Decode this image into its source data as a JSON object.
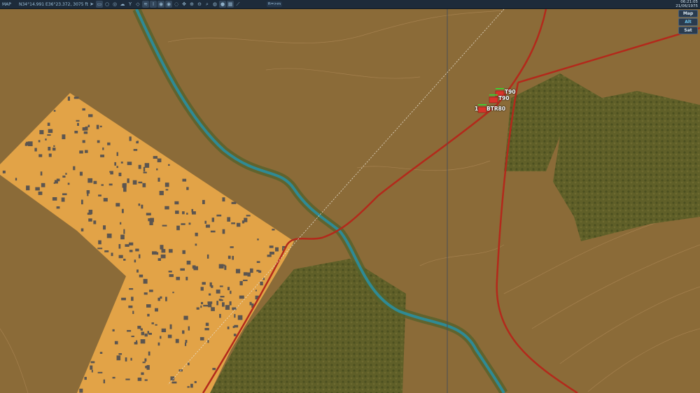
{
  "topbar": {
    "title": "MAP",
    "coords": "N34°14.991 E36°23.372, 3075 ft",
    "units_toggle": "ft=>m",
    "tools": [
      {
        "icon": "navigate-arrow-icon",
        "glyph": "➤",
        "active": false
      },
      {
        "icon": "label-toggle-icon",
        "glyph": "▭",
        "active": true
      },
      {
        "icon": "circle-icon",
        "glyph": "○",
        "active": false
      },
      {
        "icon": "layers-icon",
        "glyph": "◎",
        "active": false
      },
      {
        "icon": "cloud-icon",
        "glyph": "☁",
        "active": false
      },
      {
        "icon": "network-icon",
        "glyph": "Y",
        "active": false
      },
      {
        "icon": "target-icon",
        "glyph": "◇",
        "active": false
      },
      {
        "icon": "wifi-icon",
        "glyph": "≋",
        "active": true
      },
      {
        "icon": "tower-icon",
        "glyph": "I",
        "active": true
      },
      {
        "icon": "radar-1-icon",
        "glyph": "◉",
        "active": true
      },
      {
        "icon": "radar-2-icon",
        "glyph": "◉",
        "active": true
      },
      {
        "icon": "radar-3-icon",
        "glyph": "◌",
        "active": false
      },
      {
        "icon": "move-icon",
        "glyph": "✥",
        "active": false
      },
      {
        "icon": "zoom-in-icon",
        "glyph": "⊕",
        "active": false
      },
      {
        "icon": "zoom-out-icon",
        "glyph": "⊖",
        "active": false
      },
      {
        "icon": "search-icon",
        "glyph": "⌕",
        "active": false
      },
      {
        "icon": "globe-icon",
        "glyph": "◍",
        "active": false
      },
      {
        "icon": "sphere-icon",
        "glyph": "●",
        "active": true
      },
      {
        "icon": "grid-icon",
        "glyph": "▦",
        "active": true
      },
      {
        "icon": "ruler-icon",
        "glyph": "⟋",
        "active": false
      }
    ]
  },
  "clock": {
    "time": "06:21:05",
    "date": "21/06/1975"
  },
  "layers": [
    {
      "label": "Map",
      "active": false
    },
    {
      "label": "Alt",
      "active": true
    },
    {
      "label": "Sat",
      "active": false
    }
  ],
  "units": [
    {
      "label": "T90",
      "prefix": ""
    },
    {
      "label": "T90",
      "prefix": ""
    },
    {
      "label": "BTR80",
      "prefix": "1"
    }
  ],
  "colors": {
    "terrain": "#8b6b38",
    "town": "#e2a347",
    "forest": "#5f5f28",
    "river": "#2f8a94",
    "road": "#b3291b",
    "toolbar": "#1d2b3a",
    "unit": "#d8332a",
    "health": "#2fe02f"
  }
}
